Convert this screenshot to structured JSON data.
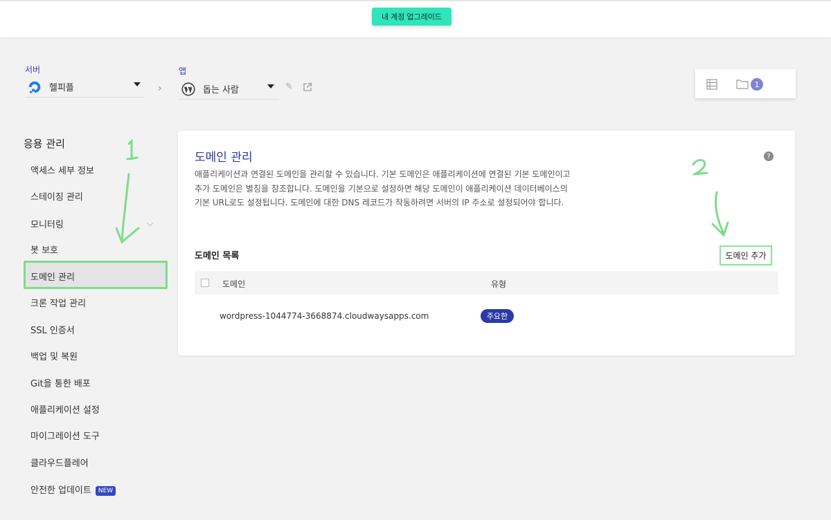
{
  "topbar": {
    "upgrade_label": "내 계정 업그레이드"
  },
  "server": {
    "label": "서버",
    "name": "헬피플"
  },
  "app": {
    "label": "앱",
    "name": "돕는 사람"
  },
  "counters": {
    "folder_count": "1"
  },
  "sidebar": {
    "title": "응용 관리",
    "items": [
      {
        "label": "액세스 세부 정보"
      },
      {
        "label": "스테이징 관리"
      },
      {
        "label": "모니터링"
      },
      {
        "label": "봇 보호"
      },
      {
        "label": "도메인 관리"
      },
      {
        "label": "크론 작업 관리"
      },
      {
        "label": "SSL 인증서"
      },
      {
        "label": "백업 및 복원"
      },
      {
        "label": "Git을 통한 배포"
      },
      {
        "label": "애플리케이션 설정"
      },
      {
        "label": "마이그레이션 도구"
      },
      {
        "label": "클라우드플레어"
      },
      {
        "label": "안전한 업데이트"
      }
    ],
    "new_badge": "NEW"
  },
  "main": {
    "title": "도메인 관리",
    "description": "애플리케이션과 연결된 도메인을 관리할 수 있습니다. 기본 도메인은 애플리케이션에 연결된 기본 도메인이고 추가 도메인은 별칭을 참조합니다. 도메인을 기본으로 설정하면 해당 도메인이 애플리케이션 데이터베이스의 기본 URL로도 설정됩니다. 도메인에 대한 DNS 레코드가 작동하려면 서버의 IP 주소로 설정되어야 합니다.",
    "help": "?",
    "list_title": "도메인 목록",
    "add_button": "도메인 추가",
    "columns": [
      "도메인",
      "유형"
    ],
    "rows": [
      {
        "domain": "wordpress-1044774-3668874.cloudwaysapps.com",
        "type": "주요한"
      }
    ]
  },
  "annotations": {
    "step1": "1",
    "step2": "2"
  },
  "colors": {
    "accent": "#2b3a9a",
    "upgrade": "#2ee6b7",
    "highlight": "#7ddc8c",
    "badge": "#2a3aa8"
  }
}
